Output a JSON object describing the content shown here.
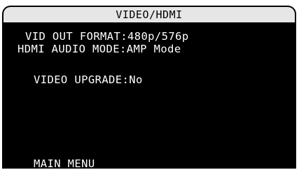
{
  "screen": {
    "title": "VIDEO/HDMI",
    "items": [
      {
        "label": "VID OUT FORMAT:",
        "value": "480p/576p"
      },
      {
        "label": "HDMI AUDIO MODE:",
        "value": "AMP Mode"
      },
      {
        "label": "VIDEO UPGRADE:",
        "value": "No"
      }
    ],
    "footer": "MAIN MENU"
  },
  "colors": {
    "background": "#000000",
    "text": "#ffffff",
    "title_bar": "#e6e6e6",
    "title_text": "#000000"
  }
}
